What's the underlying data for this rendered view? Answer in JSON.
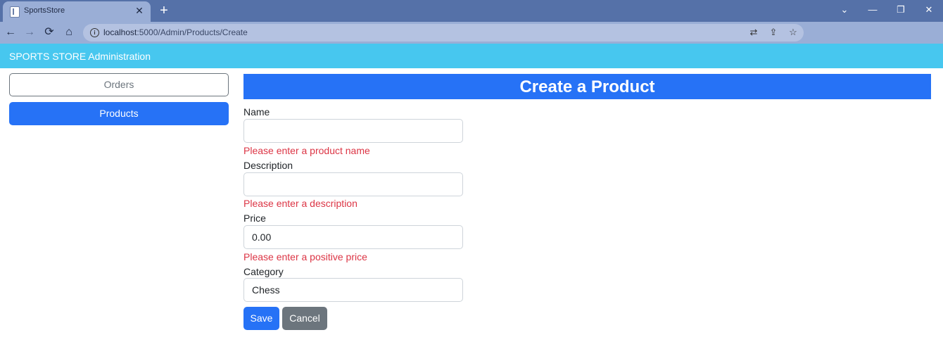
{
  "browser": {
    "tab_title": "SportsStore",
    "tab_close_glyph": "✕",
    "new_tab_glyph": "+",
    "url_host": "localhost",
    "url_rest": ":5000/Admin/Products/Create",
    "window_controls": {
      "minimize": "—",
      "restore": "❐",
      "close": "✕",
      "tabsearch": "⌄"
    }
  },
  "app": {
    "brand": "SPORTS STORE Administration"
  },
  "sidebar": {
    "items": [
      {
        "label": "Orders"
      },
      {
        "label": "Products"
      }
    ]
  },
  "main": {
    "title": "Create a Product",
    "fields": [
      {
        "label": "Name",
        "value": "",
        "error": "Please enter a product name"
      },
      {
        "label": "Description",
        "value": "",
        "error": "Please enter a description"
      },
      {
        "label": "Price",
        "value": "0.00",
        "error": "Please enter a positive price"
      },
      {
        "label": "Category",
        "value": "Chess"
      }
    ],
    "buttons": {
      "save": "Save",
      "cancel": "Cancel"
    }
  },
  "colors": {
    "appbar": "#47c7ef",
    "primary": "#2672f6",
    "secondary": "#6c757d",
    "error": "#dc3545"
  },
  "icons": [
    "favicon-icon",
    "back-arrow-icon",
    "forward-arrow-icon",
    "reload-icon",
    "home-icon",
    "info-icon",
    "translate-icon",
    "share-icon",
    "star-icon"
  ]
}
